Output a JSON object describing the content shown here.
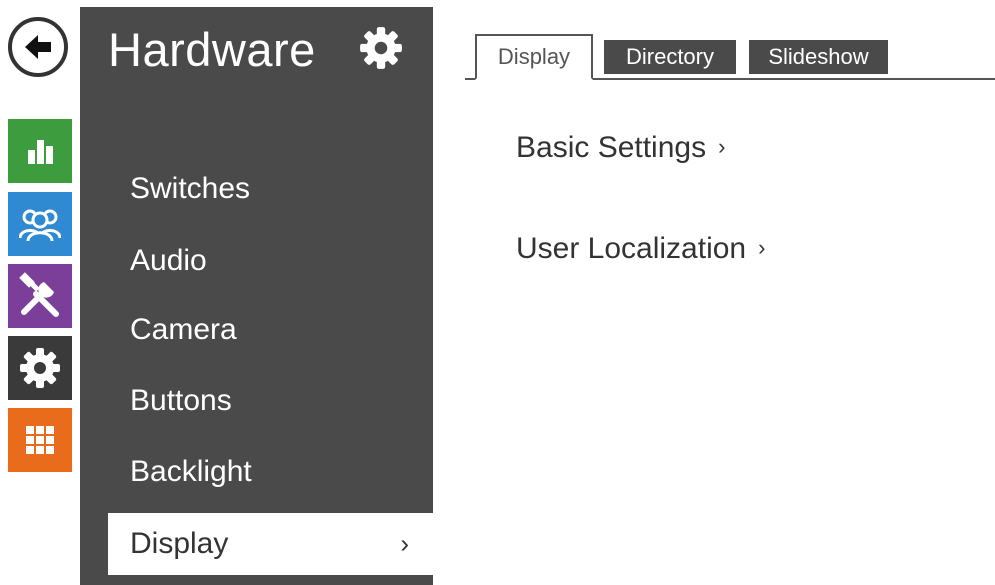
{
  "rail": {
    "back_icon": "arrow-left-icon",
    "items": [
      {
        "icon": "status-chart-icon",
        "color": "#3d9c3d"
      },
      {
        "icon": "users-icon",
        "color": "#2f8ad1"
      },
      {
        "icon": "services-tools-icon",
        "color": "#7b3f9a"
      },
      {
        "icon": "hardware-gear-icon",
        "color": "#3a3a3a"
      },
      {
        "icon": "system-grid-icon",
        "color": "#e86c1b"
      }
    ]
  },
  "sidebar": {
    "title": "Hardware",
    "settings_icon": "gear-icon",
    "items": [
      {
        "label": "Switches",
        "active": false
      },
      {
        "label": "Audio",
        "active": false
      },
      {
        "label": "Camera",
        "active": false
      },
      {
        "label": "Buttons",
        "active": false
      },
      {
        "label": "Backlight",
        "active": false
      },
      {
        "label": "Display",
        "active": true,
        "chevron": "›"
      }
    ]
  },
  "main": {
    "tabs": [
      {
        "label": "Display",
        "active": true
      },
      {
        "label": "Directory",
        "active": false
      },
      {
        "label": "Slideshow",
        "active": false
      }
    ],
    "sections": [
      {
        "label": "Basic Settings",
        "chevron": "›"
      },
      {
        "label": "User Localization",
        "chevron": "›"
      }
    ]
  },
  "colors": {
    "sidebar_bg": "#4a4a4a",
    "tab_inactive_bg": "#4a4a4a",
    "text_dark": "#333333"
  }
}
